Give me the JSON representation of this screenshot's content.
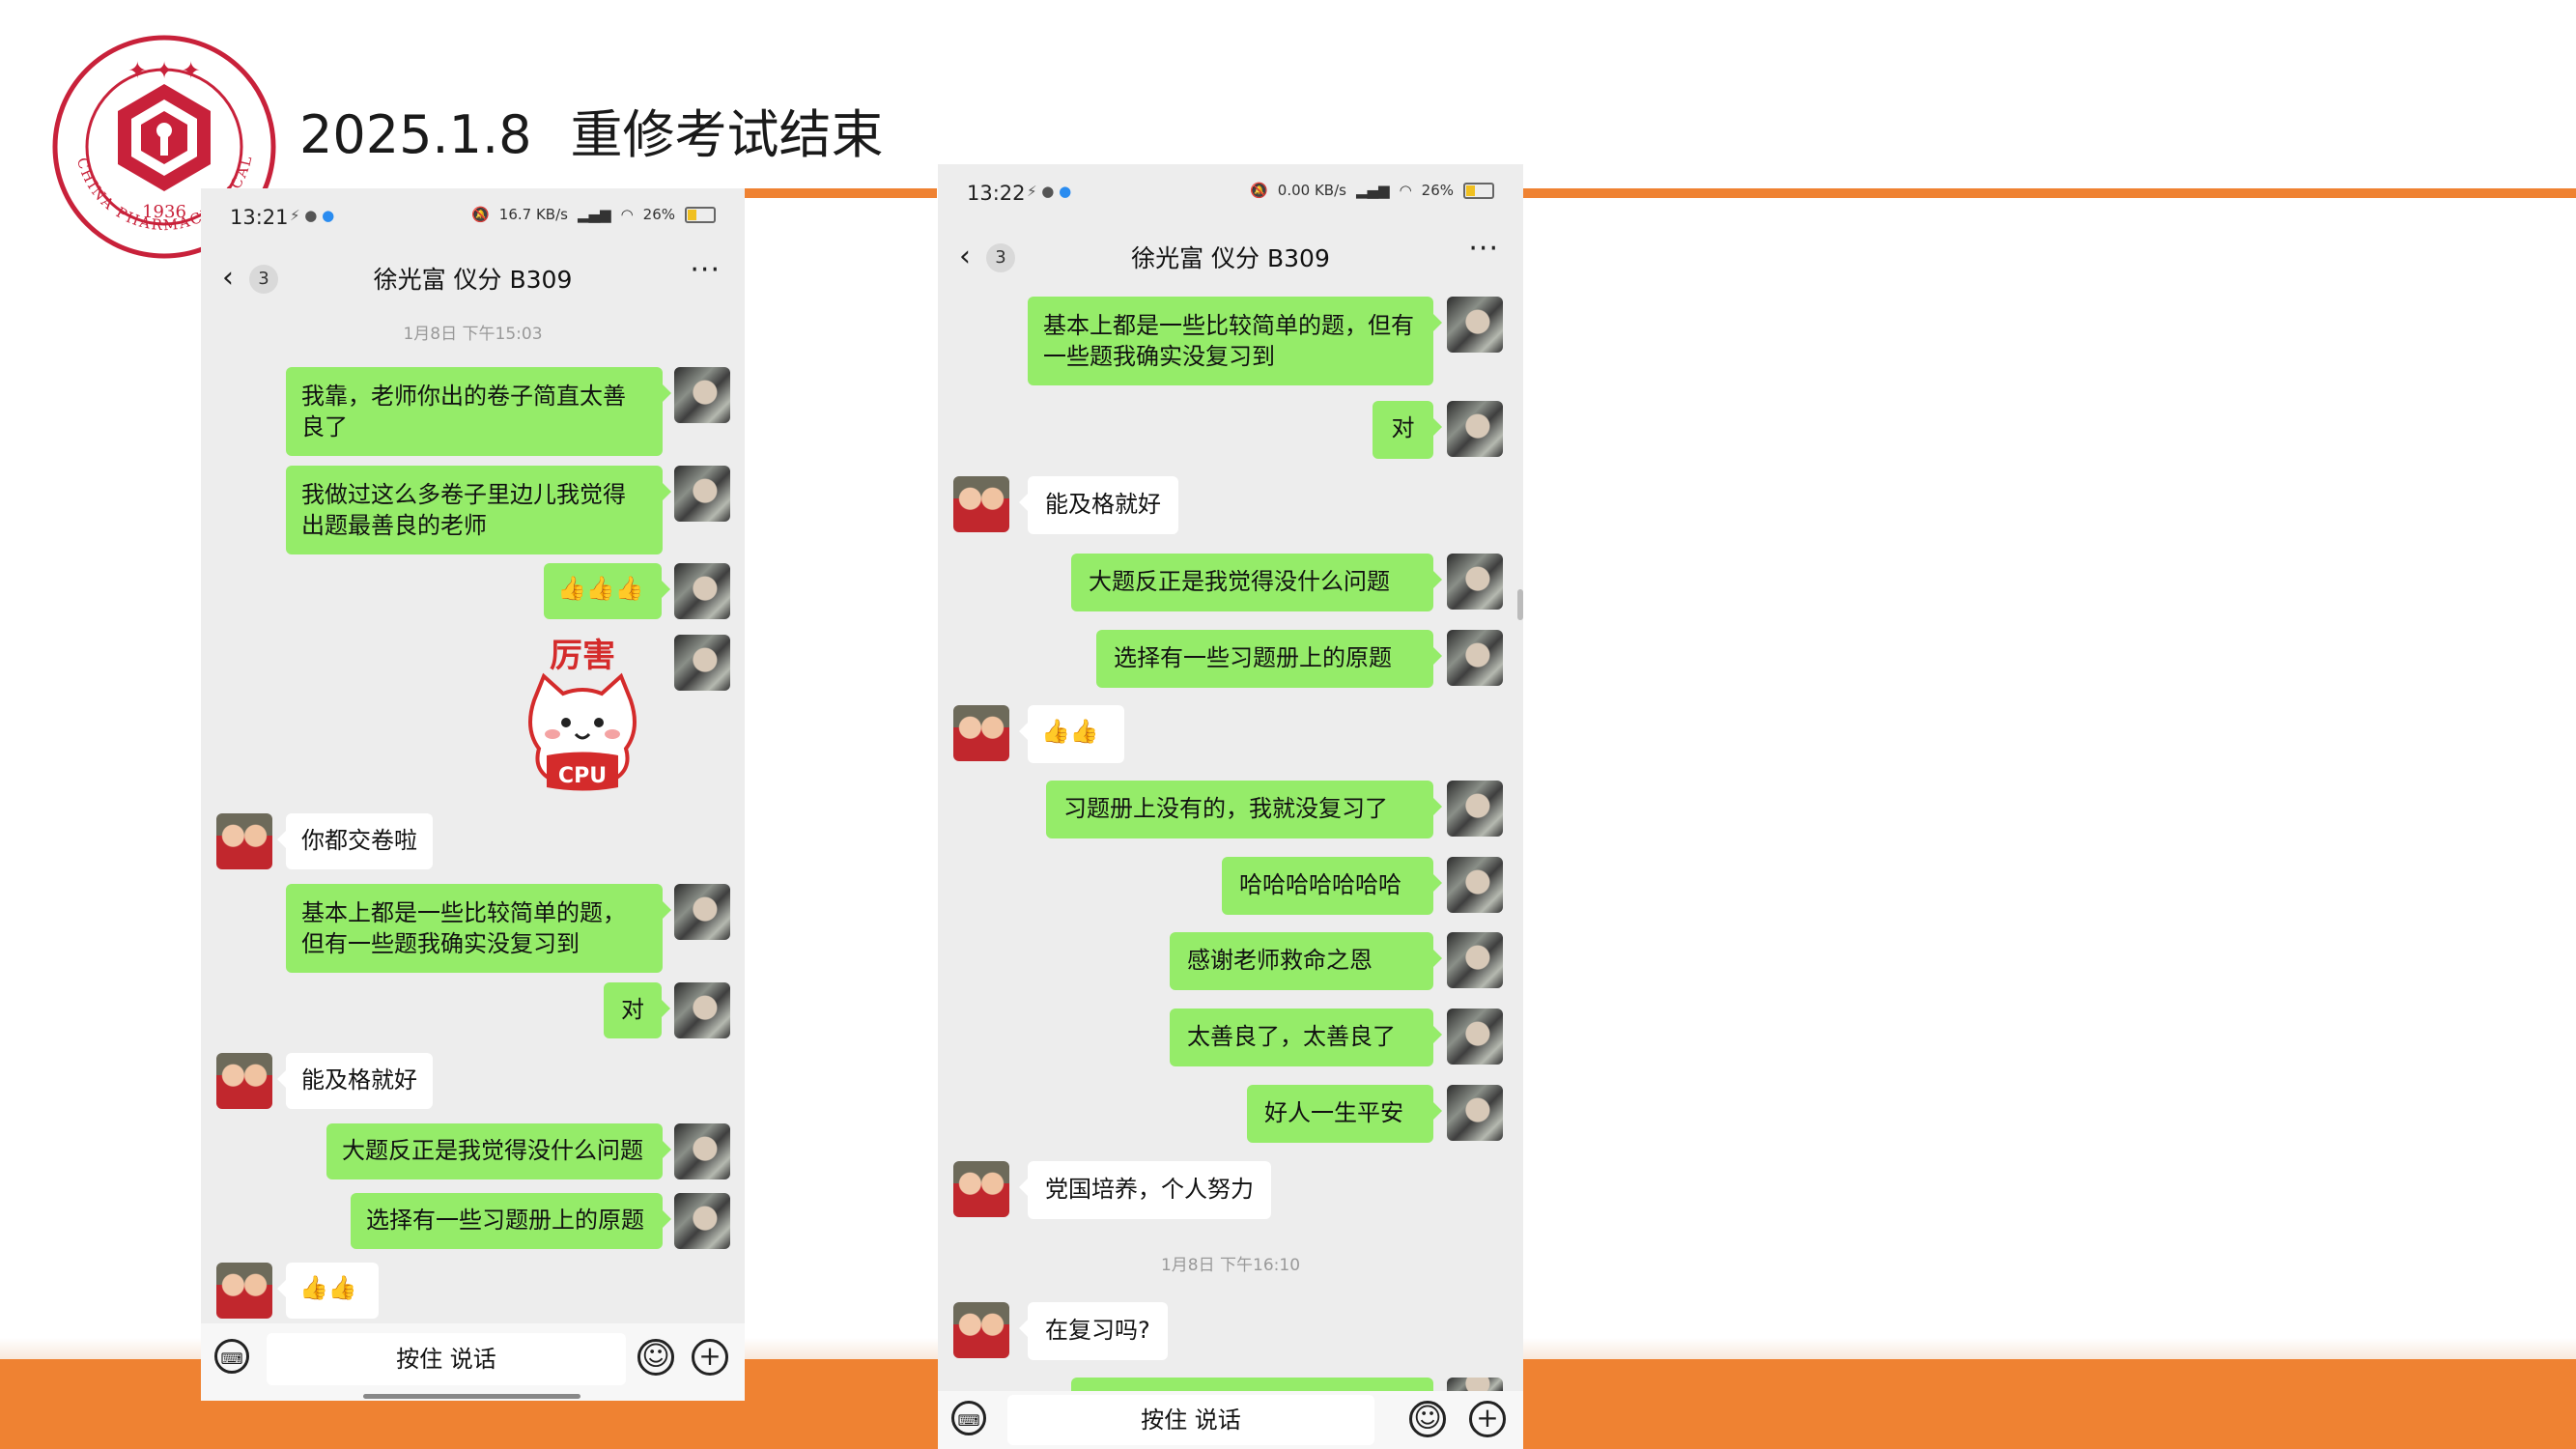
{
  "slide": {
    "title_date": "2025.1.8",
    "title_text": "重修考试结束",
    "logo": {
      "name": "china-pharmaceutical-university-seal",
      "year": "1936",
      "ring_text": "CHINA PHARMACEUTICAL UNIVERSITY",
      "colors": {
        "red": "#c8213a"
      }
    },
    "colors": {
      "accent_orange": "#ef8232",
      "bubble_green": "#95ec69"
    }
  },
  "phone_left": {
    "status_time": "13:21",
    "status_speed": "16.7 KB/s",
    "status_battery": "26%",
    "back_count": "3",
    "chat_title": "徐光富 仪分 B309",
    "timestamp": "1月8日 下午15:03",
    "messages": [
      {
        "from": "me",
        "text": "我靠，老师你出的卷子简直太善良了"
      },
      {
        "from": "me",
        "text": "我做过这么多卷子里边儿我觉得出题最善良的老师"
      },
      {
        "from": "me",
        "text": "👍👍👍"
      },
      {
        "from": "me",
        "sticker": "cat-sticker",
        "text": "厉害",
        "badge": "CPU"
      },
      {
        "from": "them",
        "text": "你都交卷啦"
      },
      {
        "from": "me",
        "text": "基本上都是一些比较简单的题，但有一些题我确实没复习到"
      },
      {
        "from": "me",
        "text": "对"
      },
      {
        "from": "them",
        "text": "能及格就好"
      },
      {
        "from": "me",
        "text": "大题反正是我觉得没什么问题"
      },
      {
        "from": "me",
        "text": "选择有一些习题册上的原题"
      },
      {
        "from": "them",
        "text": "👍👍"
      }
    ],
    "input_placeholder": "按住 说话"
  },
  "phone_right": {
    "status_time": "13:22",
    "status_speed": "0.00 KB/s",
    "status_battery": "26%",
    "back_count": "3",
    "chat_title": "徐光富 仪分 B309",
    "messages": [
      {
        "from": "me",
        "text": "基本上都是一些比较简单的题，但有一些题我确实没复习到"
      },
      {
        "from": "me",
        "text": "对"
      },
      {
        "from": "them",
        "text": "能及格就好"
      },
      {
        "from": "me",
        "text": "大题反正是我觉得没什么问题"
      },
      {
        "from": "me",
        "text": "选择有一些习题册上的原题"
      },
      {
        "from": "them",
        "text": "👍👍"
      },
      {
        "from": "me",
        "text": "习题册上没有的，我就没复习了"
      },
      {
        "from": "me",
        "text": "哈哈哈哈哈哈哈"
      },
      {
        "from": "me",
        "text": "感谢老师救命之恩"
      },
      {
        "from": "me",
        "text": "太善良了，太善良了"
      },
      {
        "from": "me",
        "text": "好人一生平安"
      },
      {
        "from": "them",
        "text": "党国培养，个人努力"
      },
      {
        "from": "them",
        "text": "在复习吗?"
      }
    ],
    "timestamp": "1月8日 下午16:10",
    "input_placeholder": "按住 说话"
  }
}
